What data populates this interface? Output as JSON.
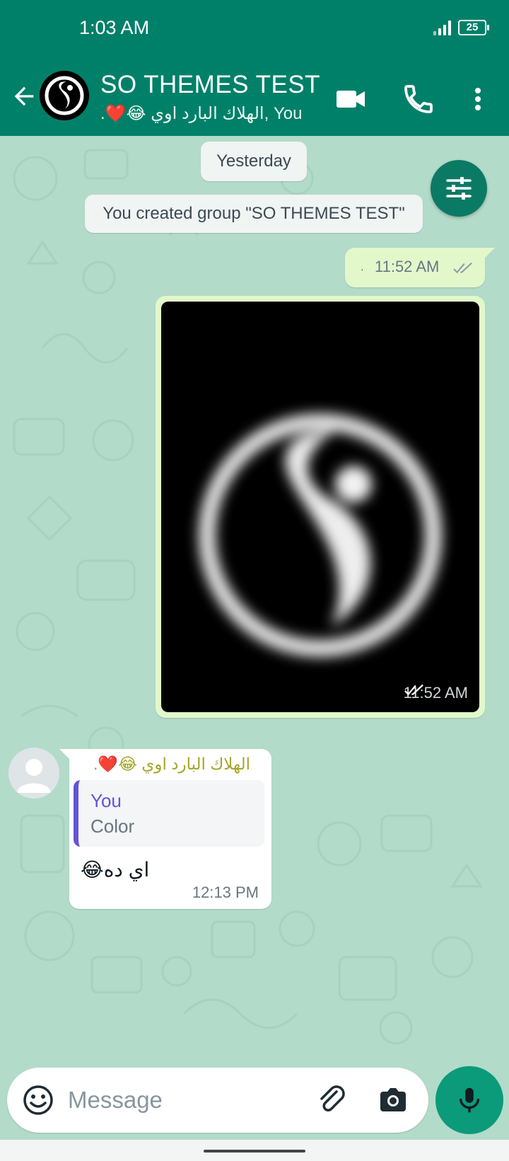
{
  "status_bar": {
    "time": "1:03 AM",
    "battery": "25"
  },
  "header": {
    "title": "SO THEMES TEST",
    "subtitle": ".❤️😂 الهلاك البارد اوي, You",
    "icons": [
      "back-arrow-icon",
      "video-call-icon",
      "voice-call-icon",
      "more-vert-icon"
    ]
  },
  "chat": {
    "date_chip": "Yesterday",
    "system_message": "You created group \"SO THEMES TEST\"",
    "messages": [
      {
        "type": "outgoing",
        "text": "·",
        "time": "11:52 AM",
        "status": "read"
      },
      {
        "type": "outgoing-image",
        "time": "11:52 AM",
        "status": "read"
      },
      {
        "type": "incoming",
        "sender": ".❤️😂 الهلاك البارد اوي",
        "sender_color": "#a6a52a",
        "quote_author": "You",
        "quote_text": "Color",
        "text": "😂اي ده",
        "time": "12:13 PM"
      }
    ]
  },
  "composer": {
    "placeholder": "Message"
  },
  "colors": {
    "header": "#008069",
    "wallpaper": "#b3dbc9",
    "outgoing_bubble": "#e2f8cb",
    "accent": "#0b9a7a",
    "quote_bar": "#6553d6"
  }
}
